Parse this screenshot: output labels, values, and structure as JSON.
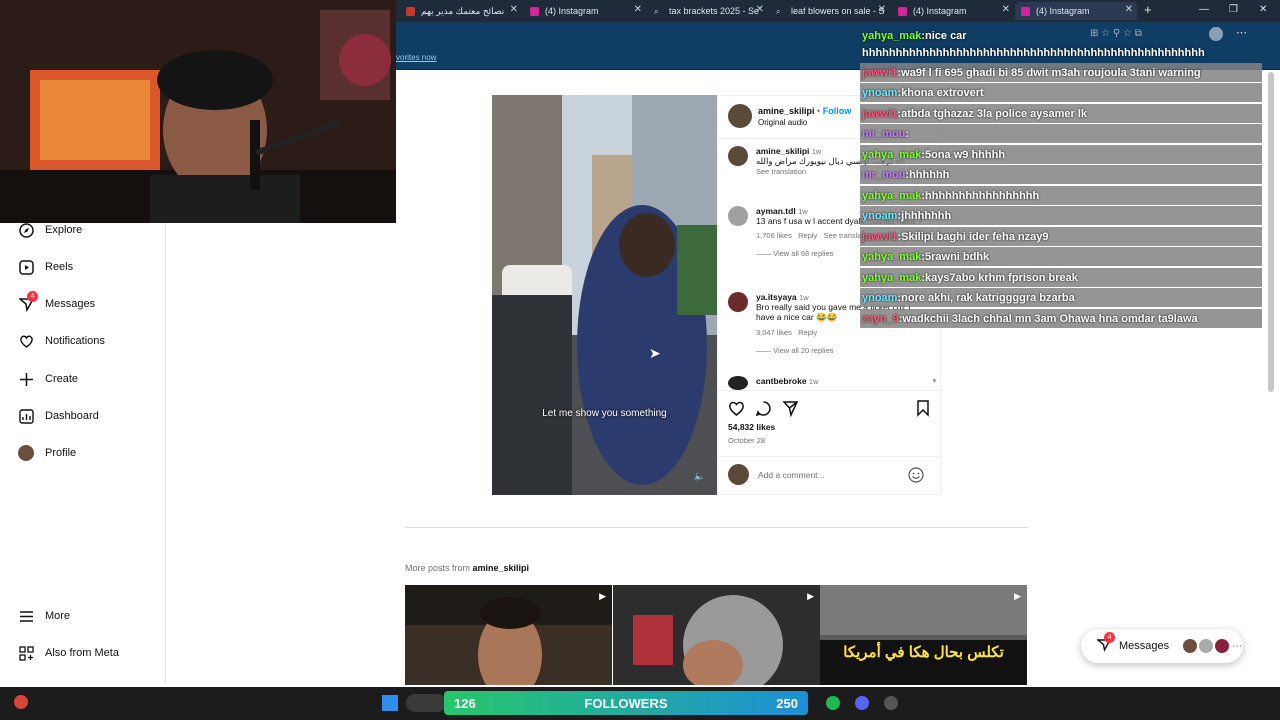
{
  "browser": {
    "tabs": [
      {
        "title": "نصائح معتمك مدير بهم",
        "active": false
      },
      {
        "title": "(4) Instagram",
        "active": false
      },
      {
        "title": "tax brackets 2025 - Se",
        "active": false
      },
      {
        "title": "leaf blowers on sale - S",
        "active": false
      },
      {
        "title": "(4) Instagram",
        "active": false
      },
      {
        "title": "(4) Instagram",
        "active": true
      }
    ],
    "new_tab": "+",
    "bookmark_link": "vorites now"
  },
  "sidebar": {
    "items": [
      {
        "label": "Explore",
        "icon": "compass-icon"
      },
      {
        "label": "Reels",
        "icon": "reels-icon"
      },
      {
        "label": "Messages",
        "icon": "messenger-icon",
        "badge": "4"
      },
      {
        "label": "Notifications",
        "icon": "heart-icon"
      },
      {
        "label": "Create",
        "icon": "plus-icon"
      },
      {
        "label": "Dashboard",
        "icon": "dashboard-icon"
      },
      {
        "label": "Profile",
        "icon": "avatar"
      }
    ],
    "bottom": [
      {
        "label": "More",
        "icon": "menu-icon"
      },
      {
        "label": "Also from Meta",
        "icon": "meta-icon"
      }
    ]
  },
  "post": {
    "username": "amine_skilipi",
    "follow": "Follow",
    "audio": "Original audio",
    "caption_overlay": "Let me show you something",
    "comments": [
      {
        "user": "amine_skilipi",
        "time": "1w",
        "text": "كرهت لونسي ديال نيويورك مراض والله us",
        "see_translation": "See translation"
      },
      {
        "user": "ayman.tdl",
        "time": "1w",
        "text": "13 ans f usa w l accent dyalk mazala haka ?",
        "likes": "1,706 likes",
        "reply": "Reply",
        "see_translation": "See translation",
        "replies": "View all 68 replies"
      },
      {
        "user": "ya.itsyaya",
        "time": "1w",
        "text": "Bro really said you gave me a ticket cuz I have a nice car 😂😂",
        "likes": "3,047 likes",
        "reply": "Reply",
        "replies": "View all 20 replies"
      },
      {
        "user": "cantbebroke",
        "time": "1w"
      }
    ],
    "likes": "54,832 likes",
    "date": "October 28",
    "add_comment_placeholder": "Add a comment..."
  },
  "more_from": {
    "prefix": "More posts from ",
    "user": "amine_skilipi"
  },
  "thumbnails": [
    {
      "caption": ""
    },
    {
      "caption": ""
    },
    {
      "caption": "تكلس بحال هكا في أمريكا"
    }
  ],
  "messages_pill": {
    "label": "Messages",
    "badge": "4"
  },
  "chat": [
    {
      "user": "yahya_mak",
      "msg": "nice car",
      "color": "#7dff3a",
      "bg": false
    },
    {
      "user": "",
      "msg": "hhhhhhhhhhhhhhhhhhhhhhhhhhhhhhhhhhhhhhhhhhhhhhhhhhh",
      "color": "#ffffff",
      "bg": false
    },
    {
      "user": "jawwi1",
      "msg": "wa9f l fi 695 ghadi bi 85 dwit m3ah roujoula 3tani warning",
      "color": "#ff5a7a",
      "bg": true
    },
    {
      "user": "ynoam",
      "msg": "khona extrovert",
      "color": "#6fe3ff",
      "bg": true
    },
    {
      "user": "jawwi1",
      "msg": "atbda tghazaz 3la police aysamer lk",
      "color": "#ff5a7a",
      "bg": true
    },
    {
      "user": "mr_mou",
      "msg": "",
      "color": "#c77dff",
      "bg": true
    },
    {
      "user": "yahya_mak",
      "msg": "5ona w9 hhhhh",
      "color": "#7dff3a",
      "bg": true
    },
    {
      "user": "mr_mou",
      "msg": "hhhhhh",
      "color": "#c77dff",
      "bg": true
    },
    {
      "user": "yahya_mak",
      "msg": "hhhhhhhhhhhhhhhhh",
      "color": "#7dff3a",
      "bg": true
    },
    {
      "user": "ynoam",
      "msg": "jhhhhhhh",
      "color": "#6fe3ff",
      "bg": true
    },
    {
      "user": "jawwi1",
      "msg": "Skilipi baghi ider feha nzay9",
      "color": "#ff5a7a",
      "bg": true
    },
    {
      "user": "yahya_mak",
      "msg": "5rawni bdhk",
      "color": "#7dff3a",
      "bg": true
    },
    {
      "user": "yahya_mak",
      "msg": "kays7abo krhm fprison break",
      "color": "#7dff3a",
      "bg": true
    },
    {
      "user": "ynoam",
      "msg": "nore akhi, rak katriggggra bzarba",
      "color": "#6fe3ff",
      "bg": true
    },
    {
      "user": "zayn_9",
      "msg": "wadkchii 3lach chhal mn 3am Ohawa hna omdar ta9lawa",
      "color": "#ff5a7a",
      "bg": true
    }
  ],
  "stream": {
    "followers_count": "126",
    "followers_label": "FOLLOWERS",
    "goal": "250"
  }
}
